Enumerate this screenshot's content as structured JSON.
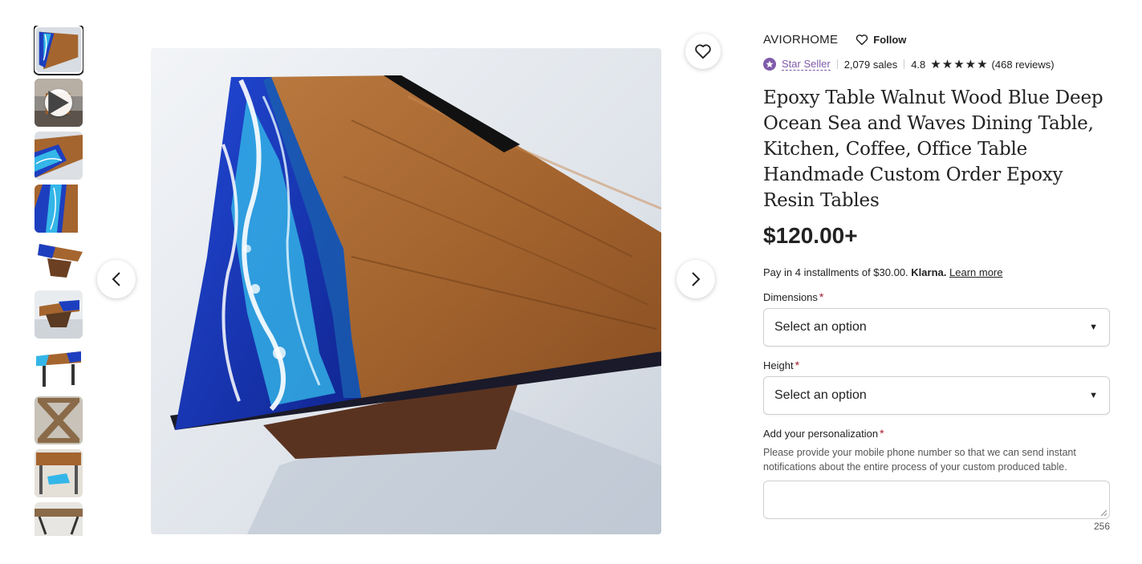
{
  "shop": {
    "name": "AVIORHOME",
    "follow_label": "Follow"
  },
  "rating": {
    "star_seller_label": "Star Seller",
    "sales": "2,079 sales",
    "score": "4.8",
    "stars": 4.8,
    "reviews": "(468 reviews)"
  },
  "product": {
    "title": "Epoxy Table Walnut Wood Blue Deep Ocean Sea and Waves Dining Table, Kitchen, Coffee, Office Table Handmade Custom Order Epoxy Resin Tables",
    "price": "$120.00+"
  },
  "klarna": {
    "text": "Pay in 4 installments of $30.00.",
    "brand": "Klarna.",
    "link": "Learn more"
  },
  "options": {
    "dimensions_label": "Dimensions",
    "dimensions_value": "Select an option",
    "height_label": "Height",
    "height_value": "Select an option",
    "required_mark": "*"
  },
  "personalization": {
    "label": "Add your personalization",
    "help": "Please provide your mobile phone number so that we can send instant notifications about the entire process of your custom produced table.",
    "value": "",
    "counter": "256"
  },
  "gallery": {
    "thumbnail_count": 10,
    "active_index": 0,
    "video_index": 1,
    "icons": [
      "heart-icon",
      "chevron-left-icon",
      "chevron-right-icon",
      "play-icon",
      "caret-down-icon",
      "star-seller-icon",
      "star-icon"
    ],
    "colors": {
      "wood": "#a5652f",
      "resin_blue": "#1d3fbf",
      "resin_light": "#34b6e8",
      "star_seller": "#7f5aa8",
      "required": "#a61a2e"
    }
  }
}
